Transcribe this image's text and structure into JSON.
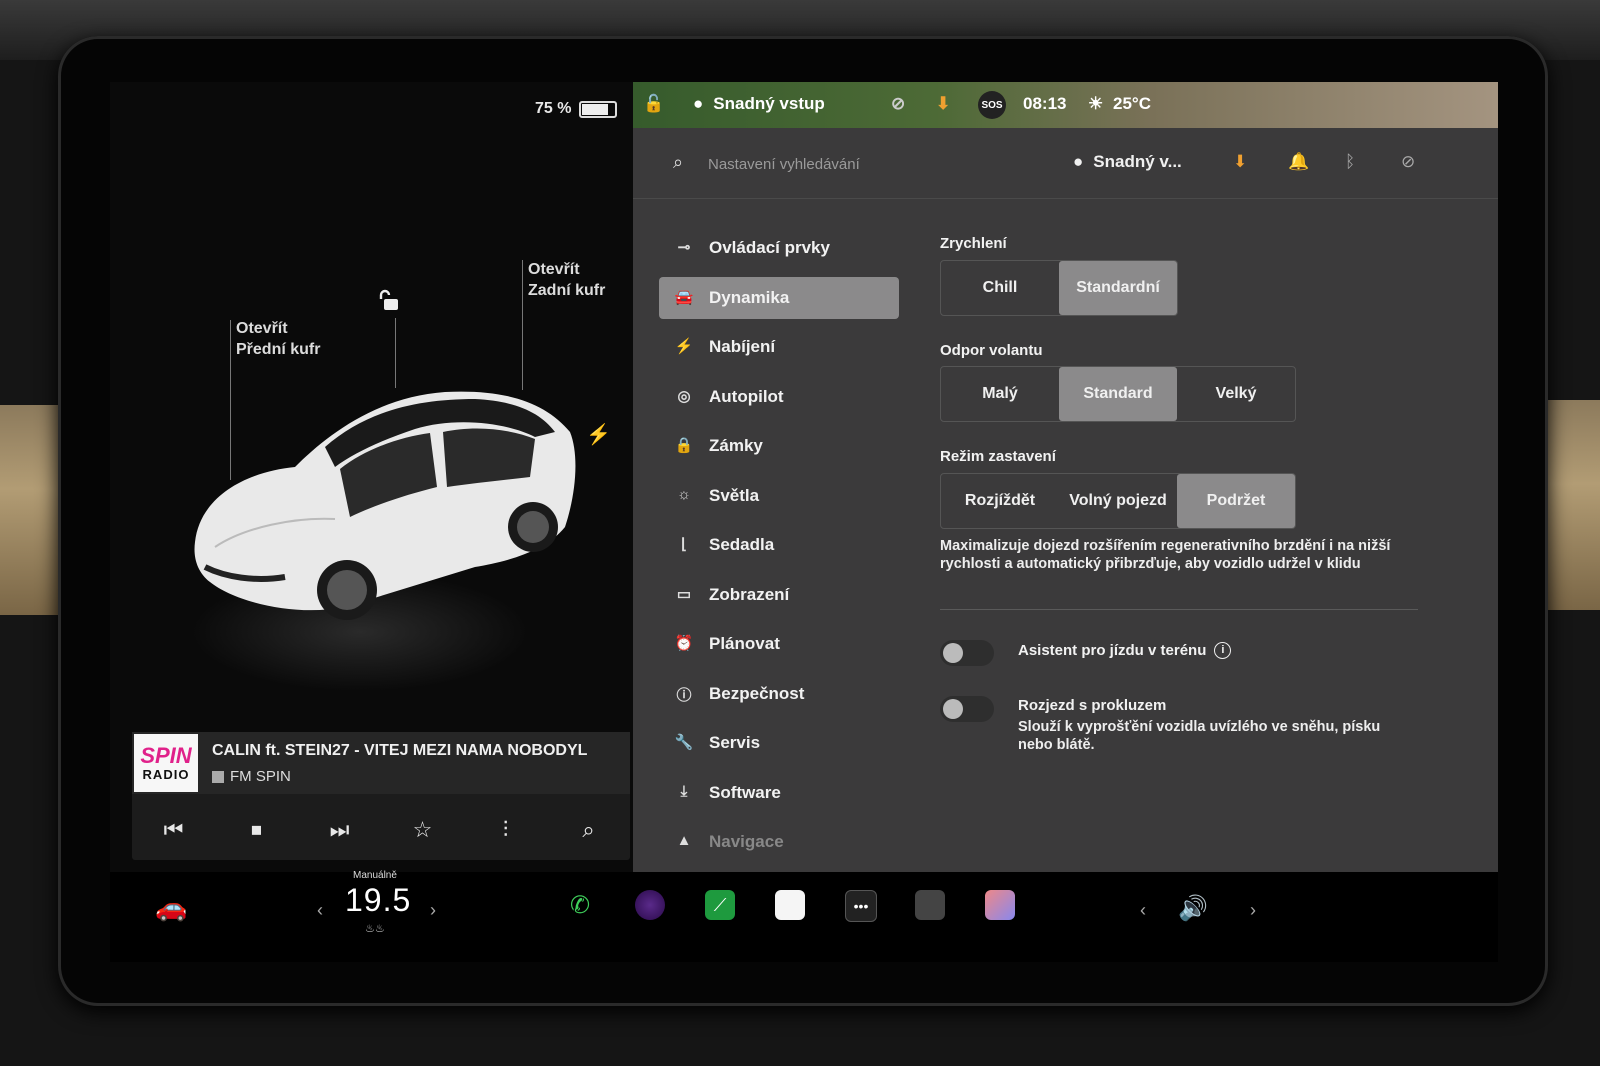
{
  "status": {
    "battery_percent": "75 %",
    "battery_level": 0.75,
    "profile_name": "Snadný vstup",
    "sos_label": "SOS",
    "time": "08:13",
    "temperature": "25°C"
  },
  "car_view": {
    "frunk_line1": "Otevřít",
    "frunk_line2": "Přední kufr",
    "trunk_line1": "Otevřít",
    "trunk_line2": "Zadní kufr"
  },
  "media": {
    "logo_top": "SPIN",
    "logo_bottom": "RADIO",
    "track_title": "CALIN ft. STEIN27 - VITEJ MEZI NAMA NOBODYL",
    "station": "FM SPIN"
  },
  "settings": {
    "search_placeholder": "Nastavení vyhledávání",
    "profile_short": "Snadný v...",
    "menu": [
      {
        "label": "Ovládací prvky",
        "icon": "toggle-icon"
      },
      {
        "label": "Dynamika",
        "icon": "car-icon"
      },
      {
        "label": "Nabíjení",
        "icon": "bolt-icon"
      },
      {
        "label": "Autopilot",
        "icon": "steering-wheel-icon"
      },
      {
        "label": "Zámky",
        "icon": "lock-icon"
      },
      {
        "label": "Světla",
        "icon": "sun-icon"
      },
      {
        "label": "Sedadla",
        "icon": "seat-icon"
      },
      {
        "label": "Zobrazení",
        "icon": "display-icon"
      },
      {
        "label": "Plánovat",
        "icon": "alarm-clock-icon"
      },
      {
        "label": "Bezpečnost",
        "icon": "alert-circle-icon"
      },
      {
        "label": "Servis",
        "icon": "wrench-icon"
      },
      {
        "label": "Software",
        "icon": "download-icon"
      },
      {
        "label": "Navigace",
        "icon": "navigation-icon"
      }
    ],
    "acceleration": {
      "title": "Zrychlení",
      "options": [
        "Chill",
        "Standardní"
      ],
      "selected": "Standardní"
    },
    "steering": {
      "title": "Odpor volantu",
      "options": [
        "Malý",
        "Standard",
        "Velký"
      ],
      "selected": "Standard"
    },
    "stopping": {
      "title": "Režim zastavení",
      "options": [
        "Rozjíždět",
        "Volný pojezd",
        "Podržet"
      ],
      "selected": "Podržet"
    },
    "stopping_desc": "Maximalizuje dojezd rozšířením regenerativního brzdění i na nižší rychlosti a automatický přibrzďuje, aby vozidlo udržel v klidu",
    "offroad_label": "Asistent pro jízdu v terénu",
    "slip_label": "Rozjezd s prokluzem",
    "slip_desc": "Slouží k vyprošťění vozidla uvízlého ve sněhu, písku nebo blátě."
  },
  "dock": {
    "climate_mode": "Manuálně",
    "temp_value": "19.5"
  }
}
